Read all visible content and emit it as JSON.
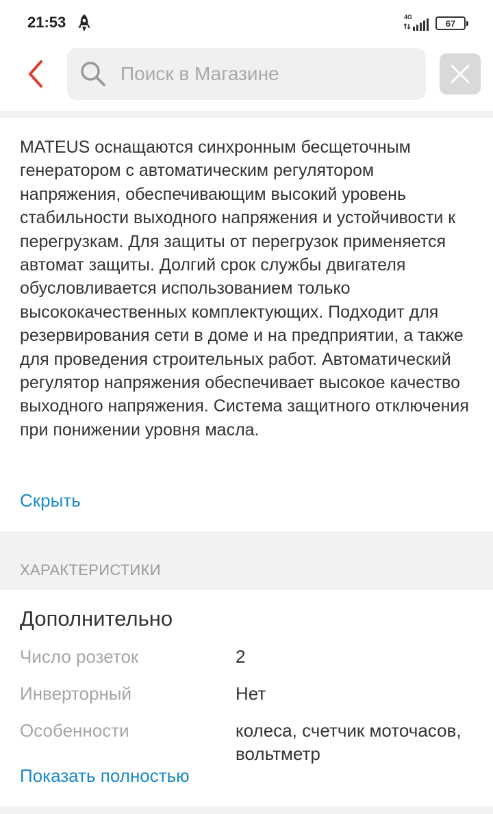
{
  "status_bar": {
    "time": "21:53",
    "network": "4G",
    "battery": "67"
  },
  "header": {
    "search_placeholder": "Поиск в Магазине"
  },
  "description": {
    "text": "MATEUS оснащаются синхронным бесщеточным генератором с автоматическим регулятором напряжения, обеспечивающим высокий уровень стабильности выходного напряжения и устойчивости к перегрузкам. Для защиты от перегрузок применяется автомат защиты. Долгий срок службы двигателя обусловливается использованием только высококачественных комплектующих. Подходит для резервирования сети в доме и на предприятии, а также для проведения строительных работ. Автоматический регулятор напряжения обеспечивает высокое качество выходного напряжения. Система защитного отключения при понижении уровня масла.",
    "hide_label": "Скрыть"
  },
  "specs": {
    "header": "ХАРАКТЕРИСТИКИ",
    "section_title": "Дополнительно",
    "rows": [
      {
        "label": "Число розеток",
        "value": "2"
      },
      {
        "label": "Инверторный",
        "value": "Нет"
      },
      {
        "label": "Особенности",
        "value": "колеса, счетчик моточасов, вольтметр"
      }
    ],
    "show_more_label": "Показать полностью"
  },
  "colors": {
    "accent_red": "#d9412f",
    "link_blue": "#1a8ac6",
    "muted_gray": "#a6a6a6"
  }
}
